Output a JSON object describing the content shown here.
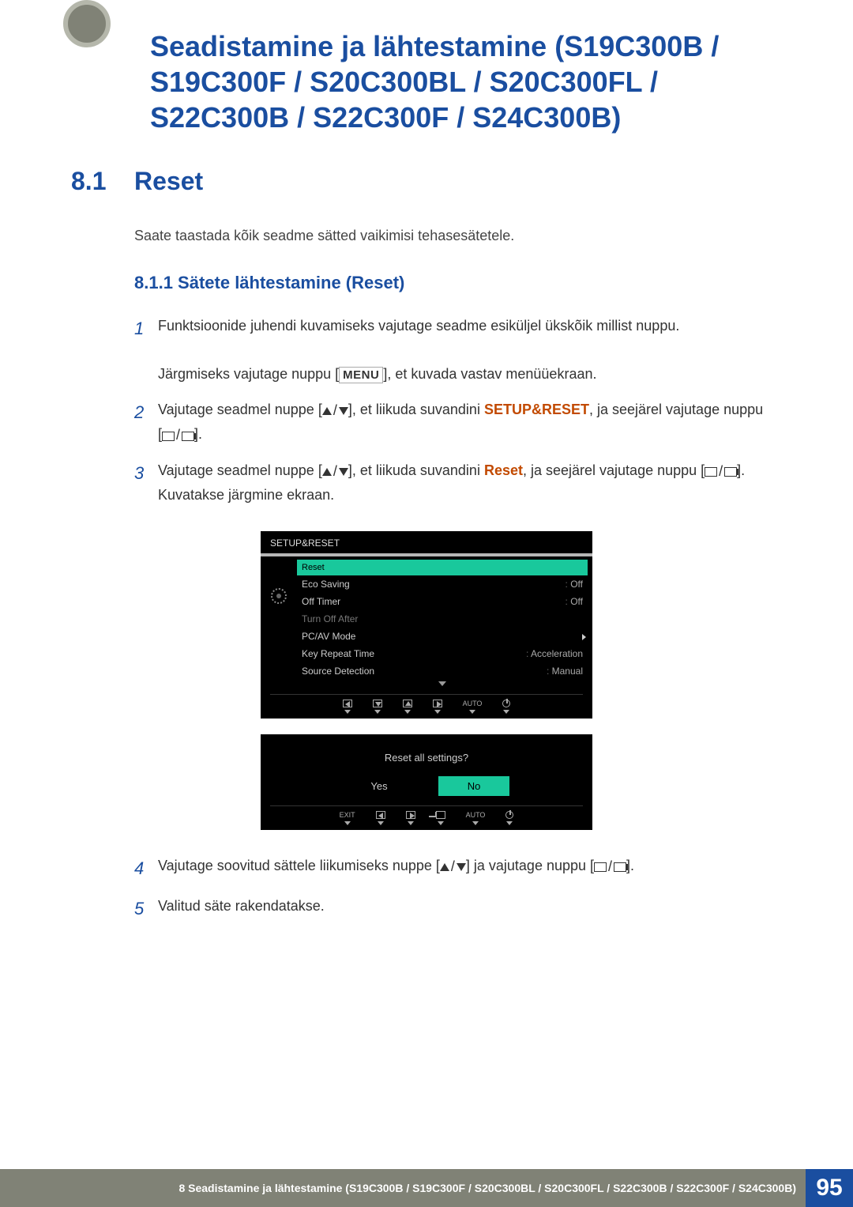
{
  "chapter_title": "Seadistamine ja lähtestamine (S19C300B / S19C300F / S20C300BL / S20C300FL / S22C300B / S22C300F / S24C300B)",
  "section": {
    "num": "8.1",
    "title": "Reset"
  },
  "intro": "Saate taastada kõik seadme sätted vaikimisi tehasesätetele.",
  "subsection": "8.1.1  Sätete lähtestamine (Reset)",
  "steps": {
    "s1a": "Funktsioonide juhendi kuvamiseks vajutage seadme esiküljel ükskõik millist nuppu.",
    "s1b_pre": "Järgmiseks vajutage nuppu [",
    "s1b_menu": "MENU",
    "s1b_post": "], et kuvada vastav menüüekraan.",
    "s2_pre": "Vajutage seadmel nuppe [",
    "s2_mid": "], et liikuda suvandini ",
    "s2_term": "SETUP&RESET",
    "s2_post": ", ja seejärel vajutage nuppu",
    "s2_close": "[",
    "s2_close2": "].",
    "s3_pre": "Vajutage seadmel nuppe [",
    "s3_mid": "], et liikuda suvandini ",
    "s3_term": "Reset",
    "s3_post": ", ja seejärel vajutage nuppu [",
    "s3_end": "].",
    "s3_after": "Kuvatakse järgmine ekraan.",
    "s4_pre": "Vajutage soovitud sättele liikumiseks nuppe [",
    "s4_mid": "] ja vajutage nuppu [",
    "s4_end": "].",
    "s5": "Valitud säte rakendatakse."
  },
  "osd": {
    "header": "SETUP&RESET",
    "items": [
      {
        "label": "Reset",
        "sel": true
      },
      {
        "label": "Eco Saving",
        "val": "Off"
      },
      {
        "label": "Off Timer",
        "val": "Off"
      },
      {
        "label": "Turn Off After",
        "dim": true
      },
      {
        "label": "PC/AV Mode",
        "arrow": true
      },
      {
        "label": "Key Repeat Time",
        "val": "Acceleration"
      },
      {
        "label": "Source Detection",
        "val": "Manual"
      }
    ],
    "nav_auto": "AUTO"
  },
  "dialog": {
    "question": "Reset all settings?",
    "yes": "Yes",
    "no": "No",
    "exit": "EXIT",
    "auto": "AUTO"
  },
  "footer": {
    "text": "8 Seadistamine ja lähtestamine (S19C300B / S19C300F / S20C300BL / S20C300FL / S22C300B / S22C300F / S24C300B)",
    "page": "95"
  }
}
